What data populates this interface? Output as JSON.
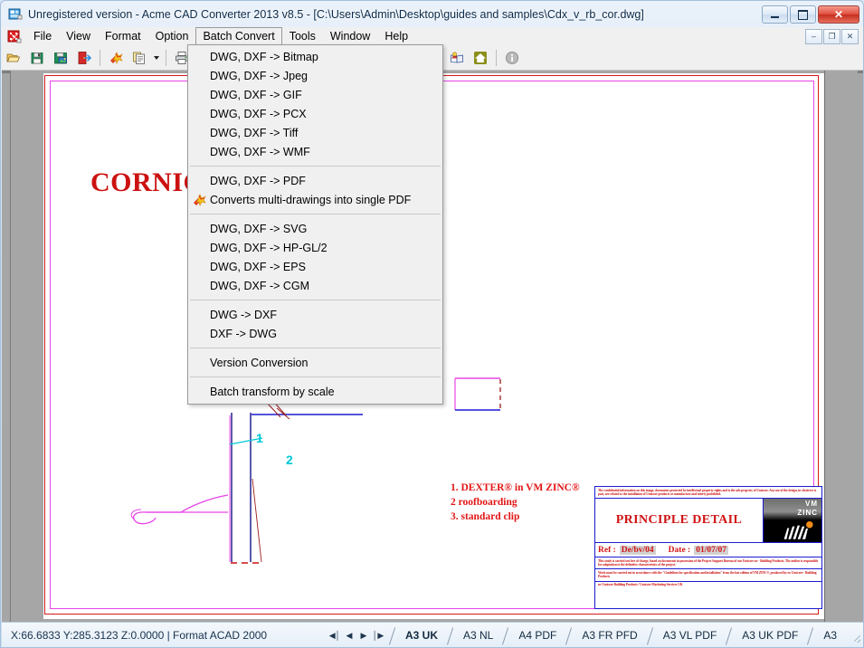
{
  "window": {
    "title": "Unregistered version - Acme CAD Converter 2013 v8.5 - [C:\\Users\\Admin\\Desktop\\guides and samples\\Cdx_v_rb_cor.dwg]",
    "icon": "app-icon",
    "caption_buttons": {
      "minimize": "minimize-button",
      "maximize": "maximize-button",
      "close_label": "✕"
    }
  },
  "menubar": {
    "items": [
      {
        "label": "File",
        "active": false
      },
      {
        "label": "View",
        "active": false
      },
      {
        "label": "Format",
        "active": false
      },
      {
        "label": "Option",
        "active": false
      },
      {
        "label": "Batch Convert",
        "active": true
      },
      {
        "label": "Tools",
        "active": false
      },
      {
        "label": "Window",
        "active": false
      },
      {
        "label": "Help",
        "active": false
      }
    ],
    "mdi_buttons": [
      {
        "label": "–",
        "name": "mdi-minimize-button"
      },
      {
        "label": "❐",
        "name": "mdi-restore-button"
      },
      {
        "label": "✕",
        "name": "mdi-close-button"
      }
    ]
  },
  "toolbar": {
    "buttons": [
      {
        "name": "open-file-button",
        "icon": "folder-open-icon"
      },
      {
        "name": "save-button",
        "icon": "floppy-disk-icon"
      },
      {
        "name": "save-as-image-button",
        "icon": "floppy-image-icon"
      },
      {
        "name": "export-button",
        "icon": "export-door-icon"
      },
      {
        "name": "batch-convert-button",
        "icon": "star-burst-icon"
      },
      {
        "name": "multi-page-button",
        "icon": "documents-icon"
      },
      {
        "name": "print-button",
        "icon": "printer-icon"
      },
      {
        "name": "register-button",
        "icon": "user-book-icon"
      },
      {
        "name": "home-button",
        "icon": "home-icon"
      },
      {
        "name": "about-button",
        "icon": "info-icon"
      }
    ]
  },
  "dropdown": {
    "name": "batch-convert-menu",
    "groups": [
      {
        "items": [
          {
            "label": "DWG, DXF -> Bitmap",
            "icon": null
          },
          {
            "label": "DWG, DXF -> Jpeg",
            "icon": null
          },
          {
            "label": "DWG, DXF -> GIF",
            "icon": null
          },
          {
            "label": "DWG, DXF -> PCX",
            "icon": null
          },
          {
            "label": "DWG, DXF -> Tiff",
            "icon": null
          },
          {
            "label": "DWG, DXF -> WMF",
            "icon": null
          }
        ]
      },
      {
        "items": [
          {
            "label": "DWG, DXF -> PDF",
            "icon": null
          },
          {
            "label": "Converts multi-drawings into single PDF",
            "icon": "star-burst-icon"
          }
        ]
      },
      {
        "items": [
          {
            "label": "DWG, DXF -> SVG",
            "icon": null
          },
          {
            "label": "DWG, DXF -> HP-GL/2",
            "icon": null
          },
          {
            "label": "DWG, DXF -> EPS",
            "icon": null
          },
          {
            "label": "DWG, DXF -> CGM",
            "icon": null
          }
        ]
      },
      {
        "items": [
          {
            "label": "DWG -> DXF",
            "icon": null
          },
          {
            "label": "DXF -> DWG",
            "icon": null
          }
        ]
      },
      {
        "items": [
          {
            "label": "Version Conversion",
            "icon": null
          }
        ]
      },
      {
        "items": [
          {
            "label": "Batch transform by scale",
            "icon": null
          }
        ]
      }
    ]
  },
  "drawing": {
    "heading": "CORNICHE",
    "notes": [
      "1. DEXTER® in VM ZINC®",
      "2 roofboarding",
      "3. standard clip"
    ],
    "callouts": [
      {
        "label": "1"
      },
      {
        "label": "2"
      }
    ],
    "titleblock": {
      "legal_top": "The confidential information on this image, documents protected by intellectual property rights and is the sole property of Umicore. Any use of the design, in whatever is part, are related to the installation of Umicore products or manufacture and utterly prohibited.",
      "title": "PRINCIPLE DETAIL",
      "ref_label": "Ref :",
      "ref_value": "De/bv/04",
      "date_label": "Date :",
      "date_value": "01/07/07",
      "note_1": "This study is carried out free of charge, based on documents in possession of the Project Support Bureau of our Umicore nv - Building Products. The author is responsible for adaptation to the definitive characteristics of the project.",
      "note_2": "Work must be carried out in accordance with the \"Guidelines for specification and installation\" from the last edition of VM ZINC®, produced by nv Umicore - Building Products",
      "note_3": "nv Umicore Building Products / Umicore Marketing Services UK",
      "logo_line1": "VM",
      "logo_line2": "ZINC"
    }
  },
  "statusbar": {
    "coordinates": "X:66.6833 Y:285.3123 Z:0.0000 | Format ACAD 2000",
    "nav": [
      {
        "label": "◀│",
        "name": "first-sheet-button"
      },
      {
        "label": "◀",
        "name": "previous-sheet-button"
      },
      {
        "label": "▶",
        "name": "next-sheet-button"
      },
      {
        "label": "│▶",
        "name": "last-sheet-button"
      }
    ],
    "tabs": [
      {
        "label": "A3 UK",
        "active": true
      },
      {
        "label": "A3 NL",
        "active": false
      },
      {
        "label": "A4 PDF",
        "active": false
      },
      {
        "label": "A3 FR PFD",
        "active": false
      },
      {
        "label": "A3 VL PDF",
        "active": false
      },
      {
        "label": "A3 UK PDF",
        "active": false
      },
      {
        "label": "A3",
        "active": false
      }
    ]
  },
  "colors": {
    "accent_red": "#cc1111",
    "border_magenta": "#e845e8",
    "cyan": "#00c8d7",
    "blue": "#1b1bd0",
    "titlebar_text": "#0b2a4a"
  }
}
